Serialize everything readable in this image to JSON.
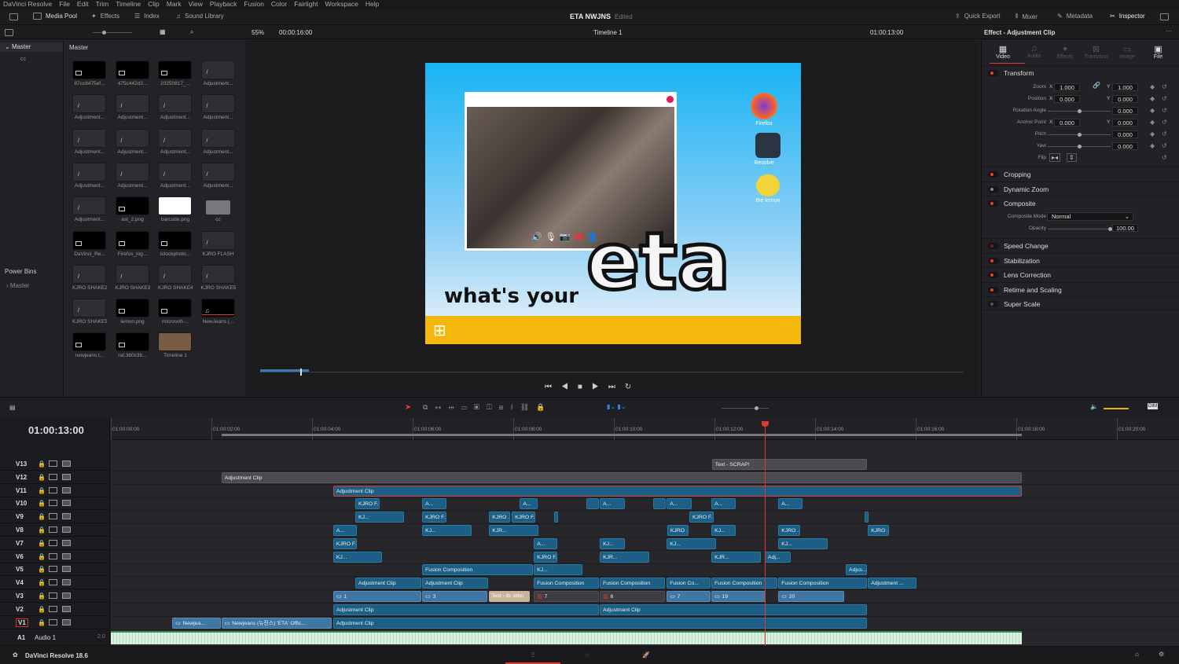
{
  "menu": [
    "DaVinci Resolve",
    "File",
    "Edit",
    "Trim",
    "Timeline",
    "Clip",
    "Mark",
    "View",
    "Playback",
    "Fusion",
    "Color",
    "Fairlight",
    "Workspace",
    "Help"
  ],
  "header": {
    "media_pool": "Media Pool",
    "effects": "Effects",
    "index": "Index",
    "sound_library": "Sound Library",
    "project": "ETA NWJNS",
    "status": "Edited",
    "quick_export": "Quick Export",
    "mixer": "Mixer",
    "metadata": "Metadata",
    "inspector": "Inspector"
  },
  "toolbar": {
    "zoom": "55%",
    "duration": "00:00:16:00",
    "timeline": "Timeline 1",
    "timecode": "01:00:13:00",
    "inspector_title": "Effect - Adjustment Clip",
    "pool_path": "Master"
  },
  "bins": {
    "master": "Master",
    "cc": "cc",
    "power_bins": "Power Bins",
    "power_master": "Master"
  },
  "media": [
    {
      "label": "87cc8475ef...",
      "type": "image"
    },
    {
      "label": "475c442d3...",
      "type": "image"
    },
    {
      "label": "20250817_...",
      "type": "image"
    },
    {
      "label": "Adjustment...",
      "type": "adj"
    },
    {
      "label": "Adjustment...",
      "type": "adj"
    },
    {
      "label": "Adjustment...",
      "type": "adj"
    },
    {
      "label": "Adjustment...",
      "type": "adj"
    },
    {
      "label": "Adjustment...",
      "type": "adj"
    },
    {
      "label": "Adjustment...",
      "type": "adj"
    },
    {
      "label": "Adjustment...",
      "type": "adj"
    },
    {
      "label": "Adjustment...",
      "type": "adj"
    },
    {
      "label": "Adjustment...",
      "type": "adj"
    },
    {
      "label": "Adjustment...",
      "type": "adj"
    },
    {
      "label": "Adjustment...",
      "type": "adj"
    },
    {
      "label": "Adjustment...",
      "type": "adj"
    },
    {
      "label": "Adjustment...",
      "type": "adj"
    },
    {
      "label": "Adjustment...",
      "type": "adj"
    },
    {
      "label": "ast_2.png",
      "type": "image"
    },
    {
      "label": "barcode.png",
      "type": "barcode"
    },
    {
      "label": "cc",
      "type": "folder"
    },
    {
      "label": "DaVinci_Re...",
      "type": "image"
    },
    {
      "label": "Firefox_log...",
      "type": "image"
    },
    {
      "label": "istockphoto...",
      "type": "image"
    },
    {
      "label": "KJRO FLASH",
      "type": "adj"
    },
    {
      "label": "KJRO SHAKE2",
      "type": "adj"
    },
    {
      "label": "KJRO SHAKE3",
      "type": "adj"
    },
    {
      "label": "KJRO SHAKE4",
      "type": "adj"
    },
    {
      "label": "KJRO SHAKE5",
      "type": "adj"
    },
    {
      "label": "KJRO SHAKE5",
      "type": "adj"
    },
    {
      "label": "lemon.png",
      "type": "image"
    },
    {
      "label": "microsoft-...",
      "type": "image"
    },
    {
      "label": "NewJeans (...",
      "type": "audio"
    },
    {
      "label": "newjeans t...",
      "type": "image"
    },
    {
      "label": "raf,360x36...",
      "type": "image"
    },
    {
      "label": "Timeline 1",
      "type": "timeline"
    }
  ],
  "viewer": {
    "caption": "what's your",
    "title": "eta",
    "icons": [
      "Firefox",
      "Resolve",
      "the lemon"
    ],
    "playhead_fraction": 0.81
  },
  "inspector": {
    "tabs": [
      "Video",
      "Audio",
      "Effects",
      "Transition",
      "Image",
      "File"
    ],
    "transform": "Transform",
    "zoom": "Zoom",
    "zoom_x": "1.000",
    "zoom_y": "1.000",
    "position": "Position",
    "pos_x": "0.000",
    "pos_y": "0.000",
    "rotation": "Rotation Angle",
    "rotation_val": "0.000",
    "anchor": "Anchor Point",
    "anchor_x": "0.000",
    "anchor_y": "0.000",
    "pitch": "Pitch",
    "pitch_val": "0.000",
    "yaw": "Yaw",
    "yaw_val": "0.000",
    "flip": "Flip",
    "x": "X",
    "y": "Y",
    "cropping": "Cropping",
    "dynamic_zoom": "Dynamic Zoom",
    "composite": "Composite",
    "composite_mode": "Composite Mode",
    "composite_mode_val": "Normal",
    "opacity": "Opacity",
    "opacity_val": "100.00",
    "speed_change": "Speed Change",
    "stabilization": "Stabilization",
    "lens_correction": "Lens Correction",
    "retime": "Retime and Scaling",
    "super_scale": "Super Scale"
  },
  "timeline": {
    "timecode": "01:00:13:00",
    "playhead_sec": 13,
    "ruler": [
      "01:00:00:00",
      "01:00:02:00",
      "01:00:04:00",
      "01:00:06:00",
      "01:00:08:00",
      "01:00:10:00",
      "01:00:12:00",
      "01:00:14:00",
      "01:00:16:00",
      "01:00:18:00",
      "01:00:20:00"
    ],
    "tracks": [
      {
        "name": "V13",
        "clips": [
          [
            "Text - SCRAP!",
            11.95,
            15.03,
            "grey"
          ]
        ]
      },
      {
        "name": "V12",
        "clips": [
          [
            "Adjustment Clip",
            2.2,
            18.11,
            "grey"
          ]
        ]
      },
      {
        "name": "V11",
        "clips": [
          [
            "Adjustment Clip",
            4.42,
            18.11,
            "blue sel"
          ]
        ]
      },
      {
        "name": "V10",
        "clips": [
          [
            "KJRO F...",
            4.86,
            5.34,
            "blue"
          ],
          [
            "A...",
            6.19,
            6.67,
            "blue"
          ],
          [
            "A...",
            8.13,
            8.48,
            "blue"
          ],
          [
            "",
            9.45,
            9.7,
            "blue"
          ],
          [
            "A...",
            9.72,
            10.22,
            "blue"
          ],
          [
            "",
            10.78,
            11.03,
            "blue"
          ],
          [
            "A...",
            11.05,
            11.55,
            "blue"
          ],
          [
            "A...",
            11.94,
            12.42,
            "blue"
          ],
          [
            "A...",
            13.27,
            13.75,
            "blue"
          ]
        ]
      },
      {
        "name": "V9",
        "clips": [
          [
            "KJ...",
            4.86,
            5.83,
            "blue"
          ],
          [
            "KJRO F...",
            6.19,
            6.67,
            "blue"
          ],
          [
            "KJRO ...",
            7.52,
            7.94,
            "blue"
          ],
          [
            "KJRO F...",
            7.97,
            8.44,
            "blue"
          ],
          [
            "",
            8.81,
            8.88,
            "blue"
          ],
          [
            "KJRO F...",
            11.5,
            11.98,
            "blue"
          ],
          [
            "",
            14.98,
            15.03,
            "blue"
          ]
        ]
      },
      {
        "name": "V8",
        "clips": [
          [
            "A...",
            4.42,
            4.89,
            "blue"
          ],
          [
            "KJ...",
            6.19,
            7.17,
            "blue"
          ],
          [
            "KJR...",
            7.52,
            8.5,
            "blue"
          ],
          [
            "KJRO ...",
            11.06,
            11.48,
            "blue"
          ],
          [
            "KJ...",
            11.94,
            12.42,
            "blue"
          ],
          [
            "KJRO ...",
            13.27,
            13.7,
            "blue"
          ],
          [
            "KJRO ...",
            15.05,
            15.47,
            "blue"
          ]
        ]
      },
      {
        "name": "V7",
        "clips": [
          [
            "KJRO F...",
            4.42,
            4.89,
            "blue"
          ],
          [
            "A...",
            8.41,
            8.88,
            "blue"
          ],
          [
            "KJ...",
            9.72,
            10.22,
            "blue"
          ],
          [
            "KJ...",
            11.05,
            12.03,
            "blue"
          ],
          [
            "KJ...",
            13.27,
            14.25,
            "blue"
          ]
        ]
      },
      {
        "name": "V6",
        "clips": [
          [
            "KJ...",
            4.42,
            5.39,
            "blue"
          ],
          [
            "KJRO F...",
            8.41,
            8.88,
            "blue"
          ],
          [
            "KJR...",
            9.72,
            10.7,
            "blue"
          ],
          [
            "KJR...",
            11.94,
            12.92,
            "blue"
          ],
          [
            "Adj...",
            13.0,
            13.52,
            "blue"
          ]
        ]
      },
      {
        "name": "V5",
        "clips": [
          [
            "Fusion Composition",
            6.19,
            8.39,
            "blue"
          ],
          [
            "KJ...",
            8.41,
            9.38,
            "blue"
          ],
          [
            "Adjus...",
            14.61,
            15.03,
            "blue"
          ]
        ]
      },
      {
        "name": "V4",
        "clips": [
          [
            "Adjustment Clip",
            4.86,
            6.17,
            "blue"
          ],
          [
            "Adjustment Clip",
            6.19,
            7.5,
            "blue"
          ],
          [
            "Fusion Composition",
            8.41,
            9.7,
            "blue"
          ],
          [
            "Fusion Composition",
            9.72,
            11.02,
            "blue"
          ],
          [
            "Fusion Co...",
            11.05,
            11.92,
            "blue"
          ],
          [
            "Fusion Composition",
            11.94,
            13.25,
            "blue"
          ],
          [
            "Fusion Composition",
            13.27,
            15.03,
            "blue"
          ],
          [
            "Adjustment ...",
            15.05,
            16.02,
            "blue"
          ]
        ]
      },
      {
        "name": "V3",
        "clips": [
          [
            "1",
            4.42,
            6.17,
            "light"
          ],
          [
            "3",
            6.19,
            7.48,
            "light"
          ],
          [
            "Text - ib: ethn",
            7.52,
            8.33,
            "beige"
          ],
          [
            "7",
            8.41,
            9.7,
            "dark"
          ],
          [
            "6",
            9.72,
            11.02,
            "dark"
          ],
          [
            "7",
            11.05,
            11.92,
            "light"
          ],
          [
            "19",
            11.94,
            13.02,
            "light"
          ],
          [
            "20",
            13.27,
            14.58,
            "light"
          ]
        ]
      },
      {
        "name": "V2",
        "clips": [
          [
            "Adjustment Clip",
            4.42,
            9.7,
            "blue"
          ],
          [
            "Adjustment Clip",
            9.72,
            15.03,
            "blue"
          ]
        ]
      },
      {
        "name": "V1",
        "clips": [
          [
            "Newjea...",
            1.22,
            2.19,
            "light"
          ],
          [
            "Newjeans (뉴진스) 'ETA' Offic...",
            2.2,
            4.39,
            "light"
          ],
          [
            "Adjustment Clip",
            4.42,
            15.03,
            "blue"
          ]
        ]
      }
    ],
    "audio": {
      "name": "A1",
      "label": "Audio 1",
      "channels": "2.0",
      "start": 0,
      "end": 18.11
    }
  },
  "colors": {
    "accent": "#ef3b2c",
    "clip": "#1b5f86",
    "playhead": "#e03a30"
  },
  "footer": {
    "app": "DaVinci Resolve 18.6"
  }
}
